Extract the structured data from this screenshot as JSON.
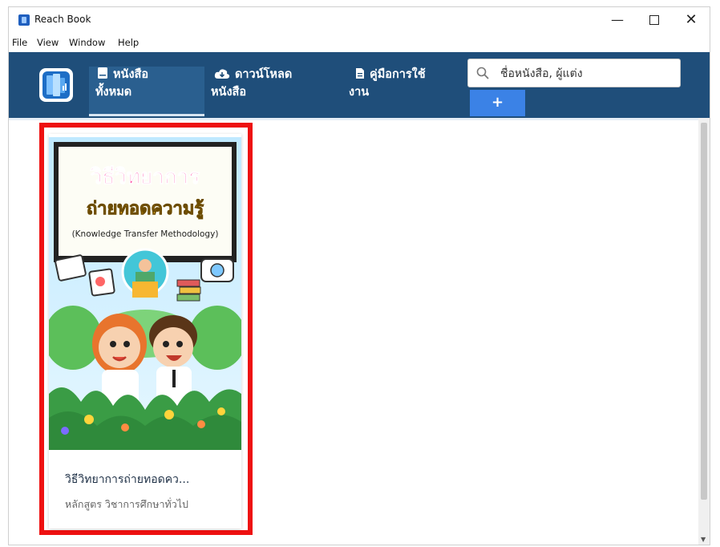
{
  "window": {
    "title": "Reach Book",
    "minimize": "—",
    "close": "✕"
  },
  "menu": [
    "File",
    "View",
    "Window",
    "Help"
  ],
  "nav": {
    "tabs": [
      {
        "line1": "หนังสือ",
        "line2": "ทั้งหมด",
        "icon": "book-icon",
        "active": true
      },
      {
        "line1": "ดาวน์โหลด",
        "line2": "หนังสือ",
        "icon": "cloud-download-icon",
        "active": false
      },
      {
        "line1": "คู่มือการใช้",
        "line2": "งาน",
        "icon": "document-icon",
        "active": false
      }
    ],
    "search_placeholder": "ชื่อหนังสือ, ผู้แต่ง",
    "add_label": "+"
  },
  "books": [
    {
      "title": "วิธีวิทยาการถ่ายทอดคว...",
      "category": "หลักสูตร วิชาการศึกษาทั่วไป",
      "cover": {
        "title_line1": "วิธีวิทยาการ",
        "title_line2": "ถ่ายทอดความรู้",
        "subtitle": "(Knowledge Transfer Methodology)"
      }
    }
  ],
  "colors": {
    "nav_bg": "#1f4e7a",
    "add_button": "#3b82e6",
    "highlight": "#ee1111"
  }
}
